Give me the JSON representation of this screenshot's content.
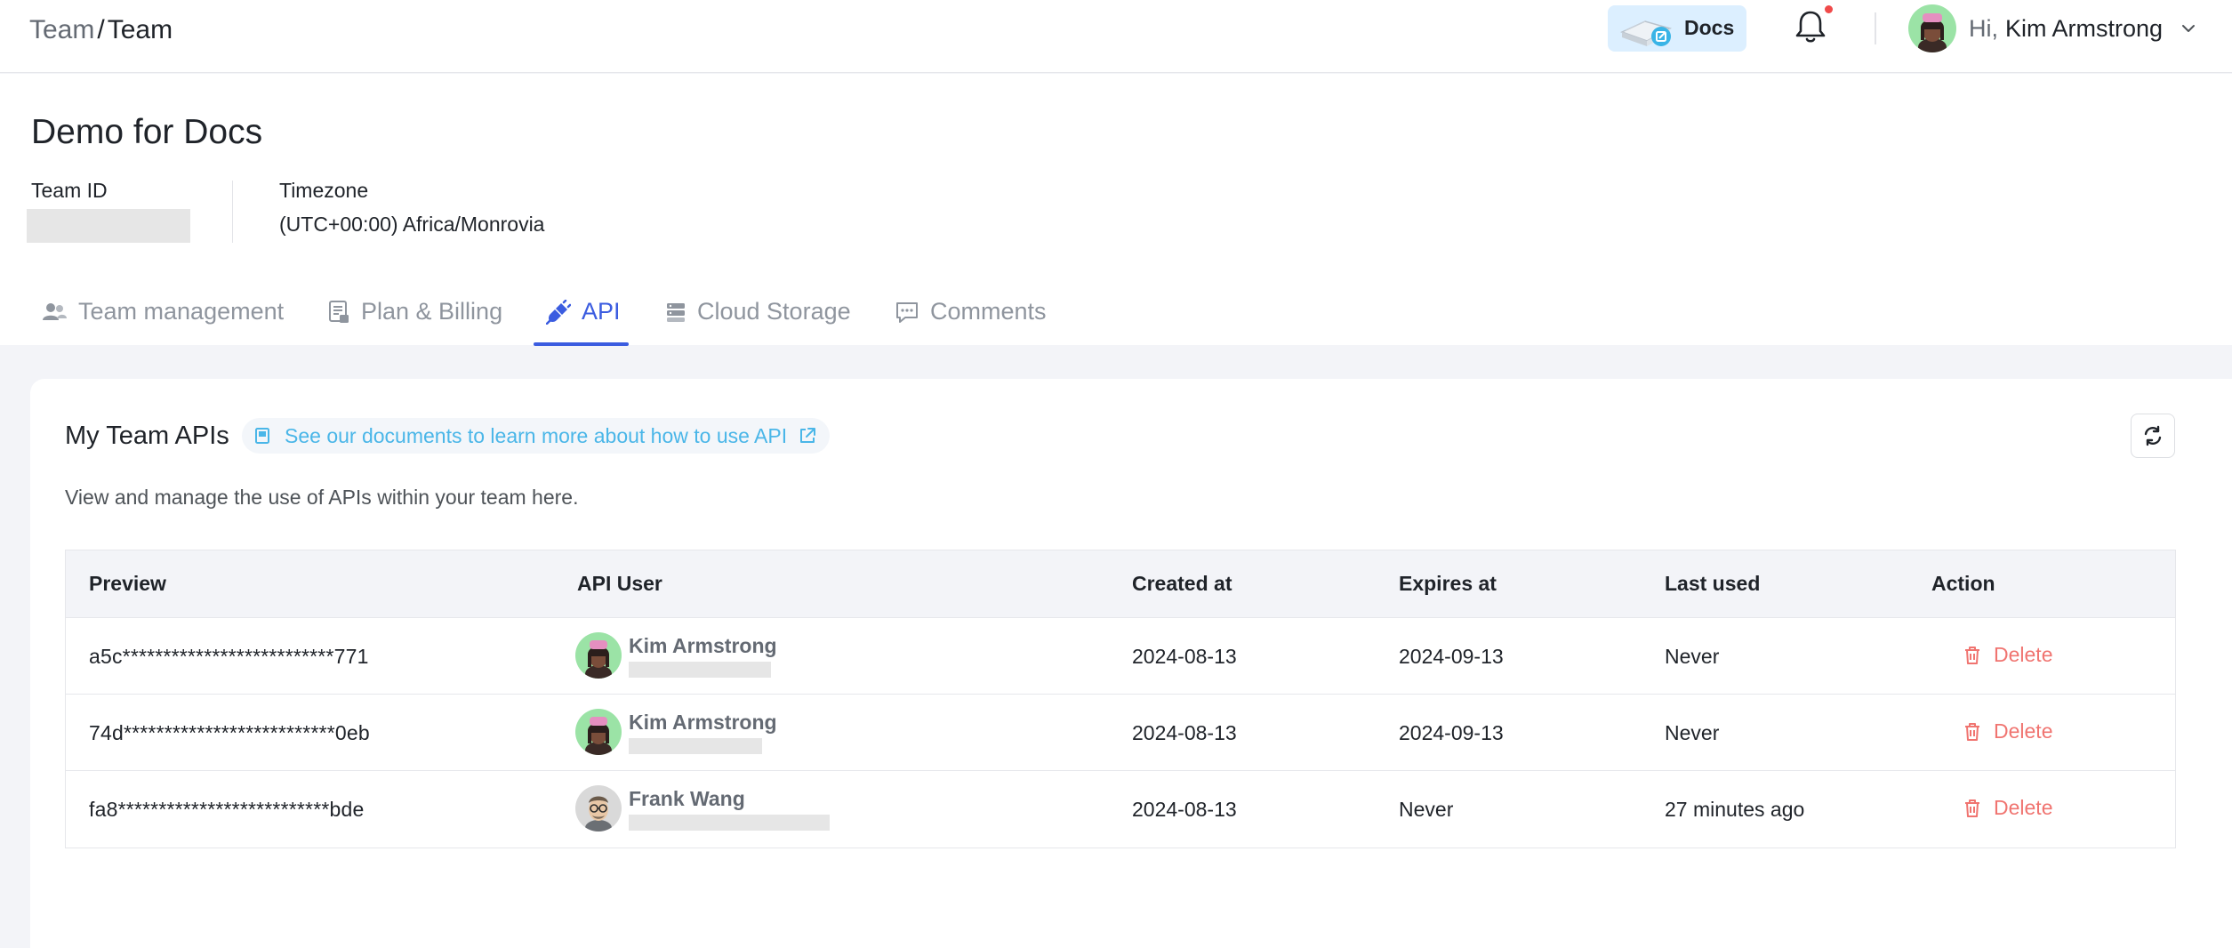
{
  "topbar": {
    "breadcrumb_parent": "Team",
    "breadcrumb_sep": "/",
    "breadcrumb_current": "Team",
    "docs_label": "Docs",
    "greeting": "Hi,",
    "user_name": "Kim Armstrong",
    "notification_dot_color": "#f04a4a"
  },
  "team": {
    "name": "Demo for Docs",
    "id_label": "Team ID",
    "timezone_label": "Timezone",
    "timezone_value": "(UTC+00:00) Africa/Monrovia"
  },
  "tabs": [
    {
      "label": "Team management",
      "icon": "team-icon",
      "active": false
    },
    {
      "label": "Plan & Billing",
      "icon": "billing-icon",
      "active": false
    },
    {
      "label": "API",
      "icon": "api-icon",
      "active": true
    },
    {
      "label": "Cloud Storage",
      "icon": "storage-icon",
      "active": false
    },
    {
      "label": "Comments",
      "icon": "comment-icon",
      "active": false
    }
  ],
  "api_section": {
    "title": "My Team APIs",
    "docs_link": "See our documents to learn more about how to use API",
    "description": "View and manage the use of APIs within your team here.",
    "columns": {
      "preview": "Preview",
      "api_user": "API User",
      "created_at": "Created at",
      "expires_at": "Expires at",
      "last_used": "Last used",
      "action": "Action"
    },
    "rows": [
      {
        "preview": "a5c**************************771",
        "user": "Kim Armstrong",
        "created_at": "2024-08-13",
        "expires_at": "2024-09-13",
        "last_used": "Never",
        "action": "Delete"
      },
      {
        "preview": "74d**************************0eb",
        "user": "Kim Armstrong",
        "created_at": "2024-08-13",
        "expires_at": "2024-09-13",
        "last_used": "Never",
        "action": "Delete"
      },
      {
        "preview": "fa8**************************bde",
        "user": "Frank Wang",
        "created_at": "2024-08-13",
        "expires_at": "Never",
        "last_used": "27 minutes ago",
        "action": "Delete"
      }
    ]
  },
  "colors": {
    "accent": "#3b5ce0",
    "link": "#4ab6e8",
    "danger": "#f07470"
  }
}
